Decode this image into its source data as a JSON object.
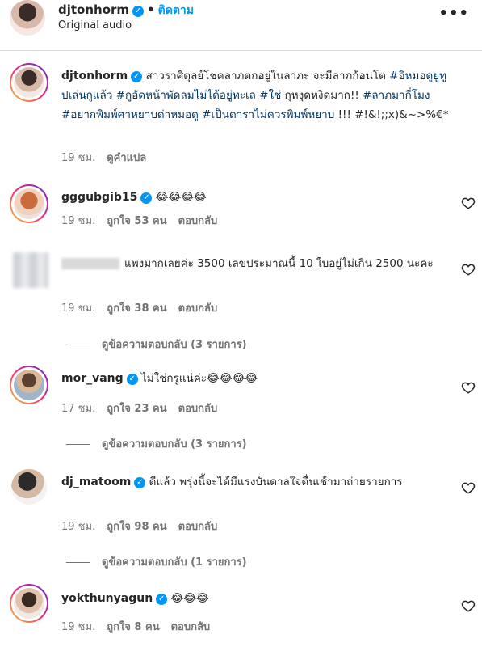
{
  "header": {
    "username": "djtonhorm",
    "follow_label": "ติดตาม",
    "separator": "•",
    "audio_label": "Original audio",
    "more_icon": "more-horizontal-icon"
  },
  "caption": {
    "username": "djtonhorm",
    "text_a": "สาวราศีตุลย์โชคลาภตกอยู่ในลาภะ จะมีลาภก้อนโต ",
    "tag1": "#อิหมอดูยูทูปเล่นกูแล้ว",
    "tag2": "#กูอัดหน้าพัดลมไม่ได้อยู่ทะเล",
    "tag3": "#ใช่",
    "text_b": " กุหงุดหงิดมาก!! ",
    "tag4": "#ลาภมากี่โมง",
    "tag5": "#อยากพิมพ์ศาหยาบด่าหมอดู",
    "tag6": "#เป็นดาราไม่ควรพิมพ์หยาบ",
    "text_c": " !!! #!&!;;x)&~>%€*",
    "time": "19 ชม.",
    "translate": "ดูคำแปล"
  },
  "comments": [
    {
      "username": "gggubgib15",
      "text": "😂😂😂😂",
      "time": "19 ชม.",
      "likes": "ถูกใจ 53 คน",
      "reply": "ตอบกลับ"
    },
    {
      "username": "",
      "text": "แพงมากเลยค่ะ 3500 เลขประมาณนี้ 10 ใบอยู่ไม่เกิน 2500 นะคะ",
      "time": "19 ชม.",
      "likes": "ถูกใจ 38 คน",
      "reply": "ตอบกลับ",
      "view_replies": "ดูข้อความตอบกลับ (3 รายการ)"
    },
    {
      "username": "mor_vang",
      "text": "ไม่ใช่กรูแน่ค่ะ😂😂😂😂",
      "time": "17 ชม.",
      "likes": "ถูกใจ 23 คน",
      "reply": "ตอบกลับ",
      "view_replies": "ดูข้อความตอบกลับ (3 รายการ)"
    },
    {
      "username": "dj_matoom",
      "text": "ดีแล้ว พรุ่งนี้จะได้มีแรงบันดาลใจตื่นเช้ามาถ่ายรายการ",
      "time": "19 ชม.",
      "likes": "ถูกใจ 98 คน",
      "reply": "ตอบกลับ",
      "view_replies": "ดูข้อความตอบกลับ (1 รายการ)"
    },
    {
      "username": "yokthunyagun",
      "text": "😂😂😂",
      "time": "19 ชม.",
      "likes": "ถูกใจ 8 คน",
      "reply": "ตอบกลับ"
    }
  ],
  "icons": {
    "verified": "verified-badge-icon",
    "like": "heart-icon"
  },
  "colors": {
    "link": "#0095f6",
    "hashtag": "#00376b",
    "muted": "#737373",
    "verified": "#0095f6"
  }
}
